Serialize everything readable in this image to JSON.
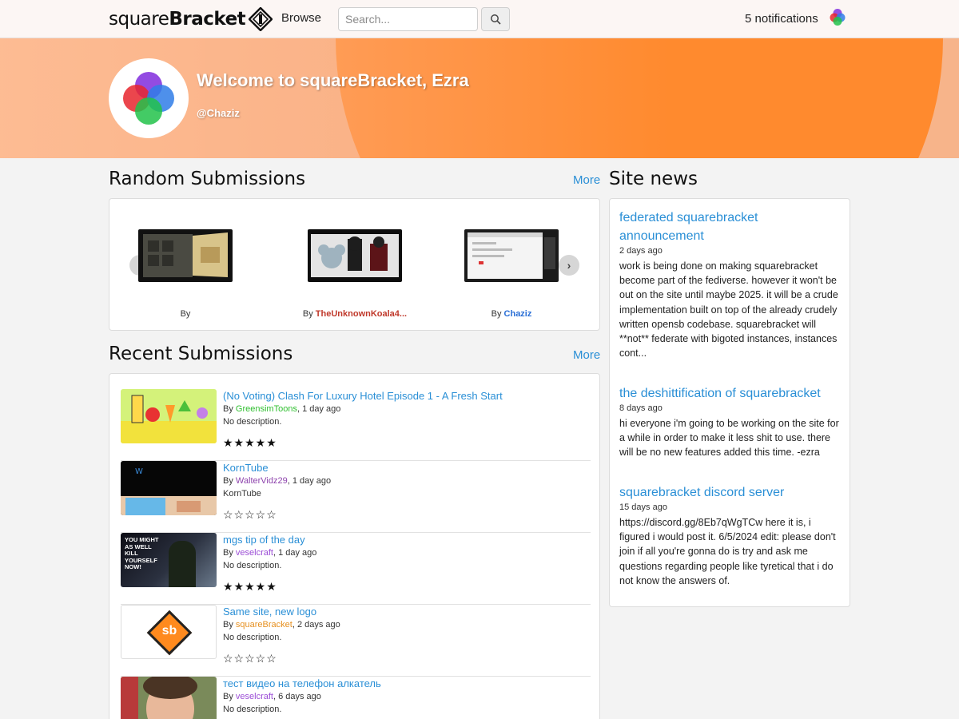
{
  "nav": {
    "brand_light": "square",
    "brand_bold": "Bracket",
    "browse": "Browse",
    "search_placeholder": "Search...",
    "notifications": "5 notifications"
  },
  "banner": {
    "welcome": "Welcome to squareBracket, Ezra",
    "handle": "@Chaziz"
  },
  "random": {
    "title": "Random Submissions",
    "more": "More",
    "items": [
      {
        "by": "By",
        "author": "",
        "author_color": "#333333"
      },
      {
        "by": "By",
        "author": "TheUnknownKoala4...",
        "author_color": "#c0392b"
      },
      {
        "by": "By",
        "author": "Chaziz",
        "author_color": "#2a6fd6"
      }
    ]
  },
  "recent": {
    "title": "Recent Submissions",
    "more": "More",
    "items": [
      {
        "title": "(No Voting) Clash For Luxury Hotel Episode 1 - A Fresh Start",
        "by": "By",
        "author": "GreensimToons",
        "author_color": "#2fbf2f",
        "time": ", 1 day ago",
        "desc": "No description.",
        "stars": "★★★★★"
      },
      {
        "title": "KornTube",
        "by": "By",
        "author": "WalterVidz29",
        "author_color": "#8e44ad",
        "time": ", 1 day ago",
        "desc": "KornTube",
        "stars": "☆☆☆☆☆"
      },
      {
        "title": "mgs tip of the day",
        "by": "By",
        "author": "veselcraft",
        "author_color": "#9b4dd6",
        "time": ", 1 day ago",
        "desc": "No description.",
        "stars": "★★★★★",
        "thumb_text": "YOU MIGHT AS WELL KILL YOURSELF NOW!"
      },
      {
        "title": "Same site, new logo",
        "by": "By",
        "author": "squareBracket",
        "author_color": "#e69020",
        "time": ", 2 days ago",
        "desc": "No description.",
        "stars": "☆☆☆☆☆",
        "thumb_text": "sb"
      },
      {
        "title": "тест видео на телефон алкатель",
        "by": "By",
        "author": "veselcraft",
        "author_color": "#9b4dd6",
        "time": ", 6 days ago",
        "desc": "No description.",
        "stars": ""
      }
    ]
  },
  "news": {
    "title": "Site news",
    "items": [
      {
        "title": "federated squarebracket announcement",
        "date": "2 days ago",
        "body": "work is being done on making squarebracket become part of the fediverse. however it won't be out on the site until maybe 2025. it will be a crude implementation built on top of the already crudely written opensb codebase. squarebracket will **not** federate with bigoted instances, instances cont..."
      },
      {
        "title": "the deshittification of squarebracket",
        "date": "8 days ago",
        "body": "hi everyone i'm going to be working on the site for a while in order to make it less shit to use. there will be no new features added this time. -ezra"
      },
      {
        "title": "squarebracket discord server",
        "date": "15 days ago",
        "body": "https://discord.gg/8Eb7qWgTCw here it is, i figured i would post it. 6/5/2024 edit: please don't join if all you're gonna do is try and ask me questions regarding people like tyretical that i do not know the answers of."
      }
    ]
  },
  "colors": {
    "accent": "#2a8fd6",
    "banner": "#ff8a2e"
  }
}
